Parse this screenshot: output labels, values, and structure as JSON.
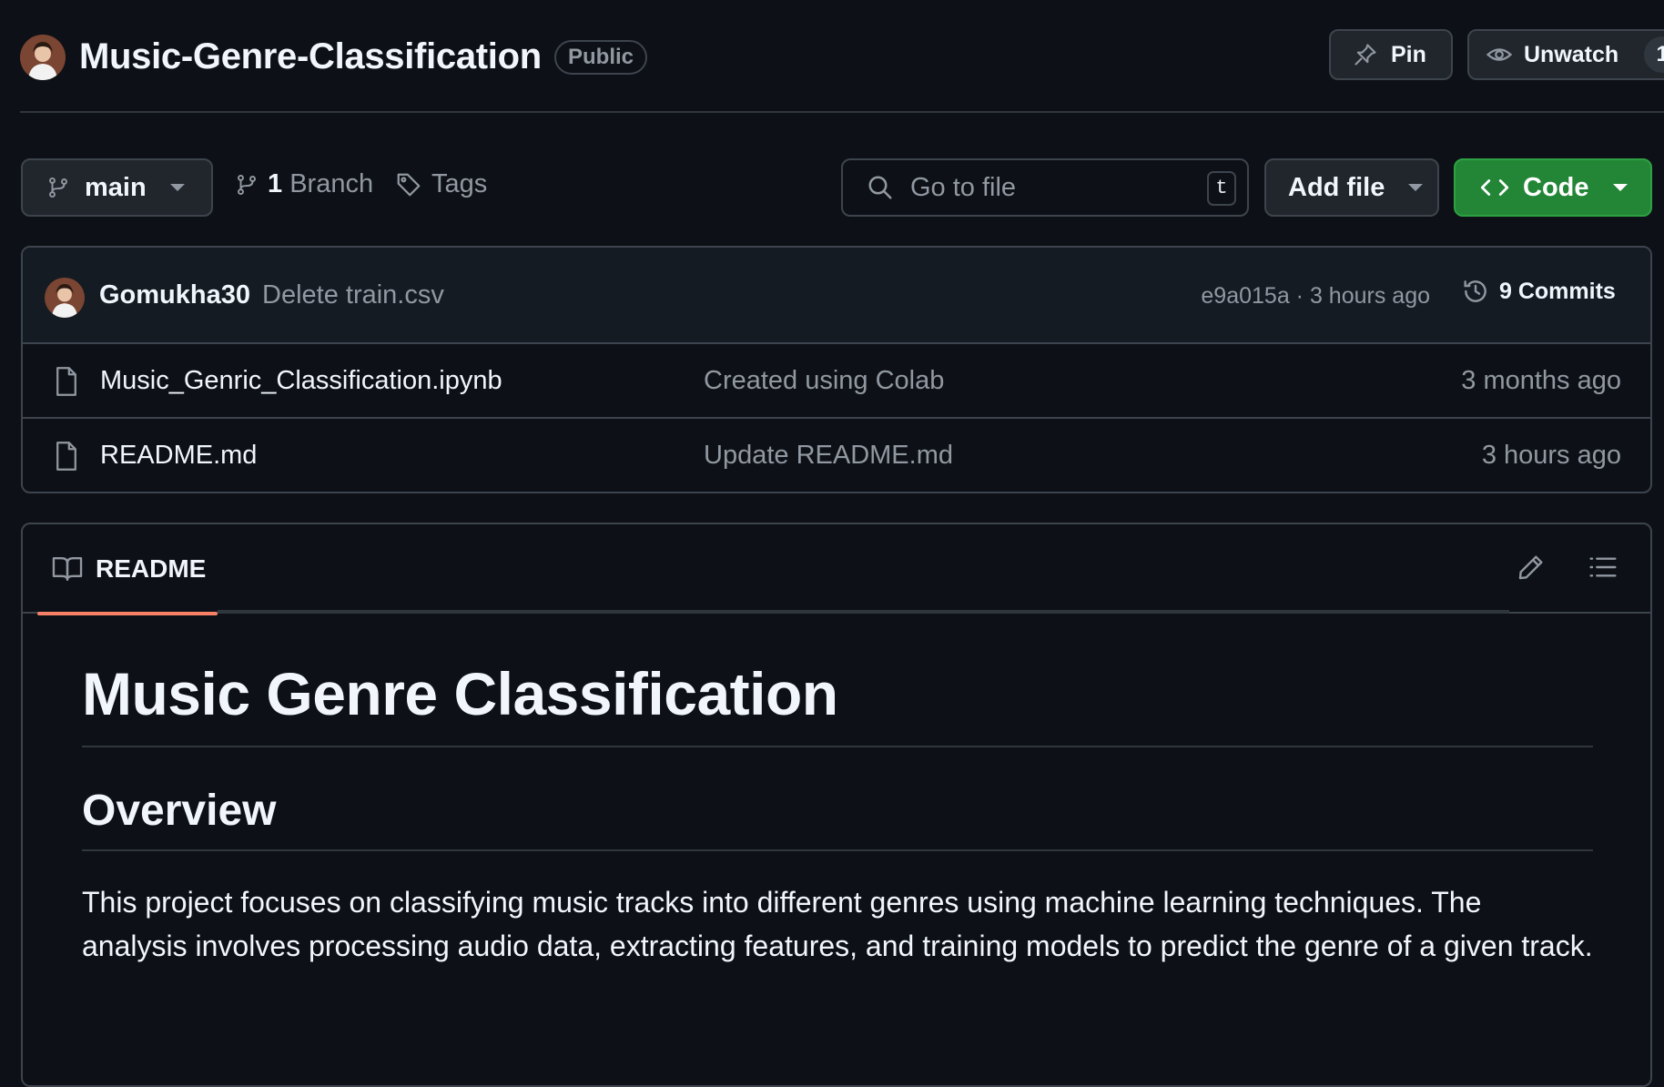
{
  "repo": {
    "name": "Music-Genre-Classification",
    "visibility": "Public"
  },
  "header_actions": {
    "pin_label": "Pin",
    "unwatch_label": "Unwatch",
    "watch_count": "1"
  },
  "toolbar": {
    "branch": "main",
    "branch_count": "1",
    "branch_label": "Branch",
    "tags_label": "Tags",
    "search_placeholder": "Go to file",
    "search_shortcut": "t",
    "add_file_label": "Add file",
    "code_label": "Code"
  },
  "latest_commit": {
    "author": "Gomukha30",
    "message": "Delete train.csv",
    "hash": "e9a015a",
    "time": "3 hours ago",
    "separator": "·",
    "commits_count": "9",
    "commits_label": "Commits"
  },
  "files": [
    {
      "name": "Music_Genric_Classification.ipynb",
      "commit": "Created using Colab",
      "time": "3 months ago"
    },
    {
      "name": "README.md",
      "commit": "Update README.md",
      "time": "3 hours ago"
    }
  ],
  "readme": {
    "tab_label": "README",
    "h1": "Music Genre Classification",
    "h2": "Overview",
    "paragraph": "This project focuses on classifying music tracks into different genres using machine learning techniques. The analysis involves processing audio data, extracting features, and training models to predict the genre of a given track."
  },
  "colors": {
    "background": "#0d1117",
    "border": "#3d444d",
    "accent_green": "#238636",
    "tab_underline": "#f78166",
    "muted_text": "#9198a1"
  },
  "icons": [
    "avatar",
    "pin-icon",
    "eye-icon",
    "branch-icon",
    "tag-icon",
    "search-icon",
    "code-icon",
    "history-icon",
    "file-icon",
    "book-icon",
    "pencil-icon",
    "list-icon"
  ]
}
